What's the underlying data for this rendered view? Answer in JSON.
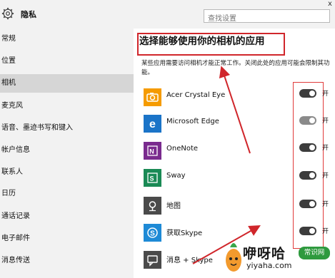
{
  "header": {
    "title": "隐私",
    "search_placeholder": "查找设置",
    "close_glyph": "x"
  },
  "sidebar": {
    "items": [
      {
        "label": "常规",
        "active": false
      },
      {
        "label": "位置",
        "active": false
      },
      {
        "label": "相机",
        "active": true
      },
      {
        "label": "麦克风",
        "active": false
      },
      {
        "label": "语音、墨迹书写和键入",
        "active": false
      },
      {
        "label": "帐户信息",
        "active": false
      },
      {
        "label": "联系人",
        "active": false
      },
      {
        "label": "日历",
        "active": false
      },
      {
        "label": "通话记录",
        "active": false
      },
      {
        "label": "电子邮件",
        "active": false
      },
      {
        "label": "消息传送",
        "active": false
      }
    ]
  },
  "main": {
    "heading": "选择能够使用你的相机的应用",
    "description": "某些应用需要访问相机才能正常工作。关闭此处的应用可能会限制其功能。",
    "apps": [
      {
        "name": "Acer Crystal Eye",
        "icon": "camera-icon",
        "color": "#f59b00",
        "toggle": "开",
        "on": true
      },
      {
        "name": "Microsoft Edge",
        "icon": "edge-icon",
        "color": "#1b74c8",
        "toggle": "开",
        "on": true
      },
      {
        "name": "OneNote",
        "icon": "onenote-icon",
        "color": "#7a2b8e",
        "toggle": "开",
        "on": true
      },
      {
        "name": "Sway",
        "icon": "sway-icon",
        "color": "#1a8a55",
        "toggle": "开",
        "on": true
      },
      {
        "name": "地图",
        "icon": "maps-icon",
        "color": "#4a4a4a",
        "toggle": "开",
        "on": true
      },
      {
        "name": "获取Skype",
        "icon": "skype-icon",
        "color": "#1e8ad6",
        "toggle": "开",
        "on": true
      },
      {
        "name": "消息 + Skype",
        "icon": "messaging-icon",
        "color": "#4a4a4a",
        "toggle": "",
        "on": true
      }
    ]
  },
  "watermark": {
    "brand": "咿呀哈",
    "badge": "常识网",
    "url": "yiyaha.com"
  },
  "colors": {
    "annotation_red": "#d0262b",
    "toggle_on": "#3c3c3c",
    "toggle_dim": "#8a8a8a",
    "sidebar_active": "#d6d6d6"
  }
}
